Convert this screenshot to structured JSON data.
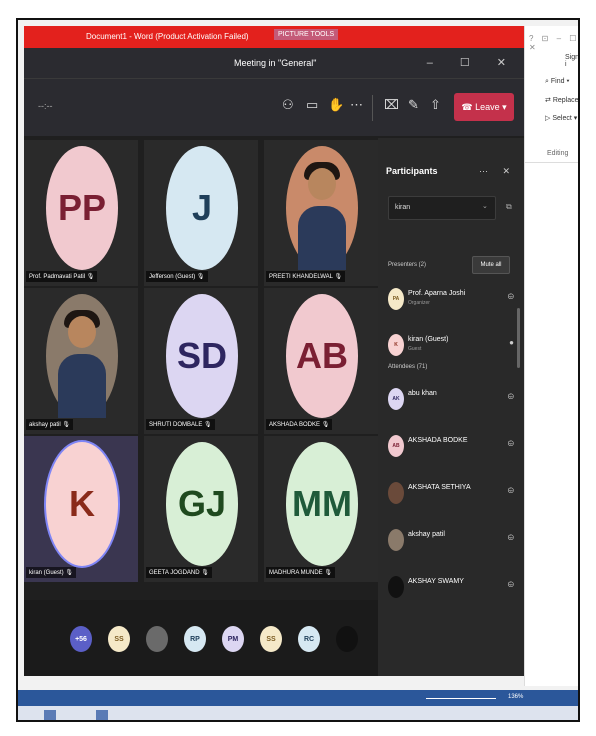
{
  "word": {
    "title": "Document1 - Word (Product Activation Failed)",
    "picture_tools": "PICTURE TOOLS",
    "window_controls": "? ⊡ – ☐ ✕",
    "sign_in": "Sign i",
    "find": "Find",
    "replace": "Replace",
    "select": "Select",
    "editing": "Editing",
    "zoom": "136%"
  },
  "teams": {
    "window_title": "Meeting in \"General\"",
    "window_controls": "–  ☐  ✕",
    "timer": "--:--",
    "leave_label": "Leave",
    "tiles": [
      {
        "initials": "PP",
        "name": "Prof. Padmavati Patil",
        "bg": "#f1c9cf",
        "fg": "#7a1f33",
        "photo": false
      },
      {
        "initials": "J",
        "name": "Jefferson (Guest)",
        "bg": "#d6e8f2",
        "fg": "#1f3f5a",
        "photo": false
      },
      {
        "initials": "",
        "name": "PREETI KHANDELWAL",
        "bg": "#c98a6a",
        "fg": "#fff",
        "photo": true
      },
      {
        "initials": "",
        "name": "akshay patil",
        "bg": "#8a7a6a",
        "fg": "#fff",
        "photo": true
      },
      {
        "initials": "SD",
        "name": "SHRUTI DOMBALE",
        "bg": "#dcd6f2",
        "fg": "#2e2660",
        "photo": false
      },
      {
        "initials": "AB",
        "name": "AKSHADA BODKE",
        "bg": "#f1c9cf",
        "fg": "#7a1f33",
        "photo": false
      },
      {
        "initials": "K",
        "name": "kiran (Guest)",
        "bg": "#f8d2d2",
        "fg": "#8a2a1a",
        "photo": false
      },
      {
        "initials": "GJ",
        "name": "GEETA JOGDAND",
        "bg": "#d8efd6",
        "fg": "#1f4a1f",
        "photo": false
      },
      {
        "initials": "MM",
        "name": "MADHURA MUNDE",
        "bg": "#d8efd6",
        "fg": "#1f5a3a",
        "photo": false
      }
    ],
    "strip": [
      {
        "label": "+56",
        "bg": "#5b5fc7",
        "fg": "#fff"
      },
      {
        "label": "SS",
        "bg": "#f5e9c8",
        "fg": "#7a5a1f"
      },
      {
        "label": "",
        "bg": "#6a6a6a",
        "fg": "#fff"
      },
      {
        "label": "RP",
        "bg": "#d6e8f2",
        "fg": "#1f3f5a"
      },
      {
        "label": "PM",
        "bg": "#dcd6f2",
        "fg": "#2e2660"
      },
      {
        "label": "SS",
        "bg": "#f5e9c8",
        "fg": "#7a5a1f"
      },
      {
        "label": "RC",
        "bg": "#d6e8f2",
        "fg": "#1f3f5a"
      },
      {
        "label": "",
        "bg": "#111111",
        "fg": "#fff"
      }
    ]
  },
  "panel": {
    "title": "Participants",
    "search_value": "kiran",
    "presenters_label": "Presenters (2)",
    "mute_all": "Mute all",
    "attendees_label": "Attendees (71)",
    "presenters": [
      {
        "name": "Prof. Aparna Joshi",
        "role": "Organizer",
        "initials": "PA",
        "bg": "#f5e9c8",
        "fg": "#7a5a1f"
      },
      {
        "name": "kiran (Guest)",
        "role": "Guest",
        "initials": "K",
        "bg": "#f8d2d2",
        "fg": "#8a2a1a"
      }
    ],
    "attendees": [
      {
        "name": "abu khan",
        "initials": "AK",
        "bg": "#dcd6f2",
        "fg": "#2e2660"
      },
      {
        "name": "AKSHADA BODKE",
        "initials": "AB",
        "bg": "#f1c9cf",
        "fg": "#7a1f33"
      },
      {
        "name": "AKSHATA SETHIYA",
        "initials": "",
        "bg": "#6a4a3a",
        "fg": "#fff"
      },
      {
        "name": "akshay patil",
        "initials": "",
        "bg": "#8a7a6a",
        "fg": "#fff"
      },
      {
        "name": "AKSHAY SWAMY",
        "initials": "",
        "bg": "#111111",
        "fg": "#fff"
      }
    ]
  }
}
